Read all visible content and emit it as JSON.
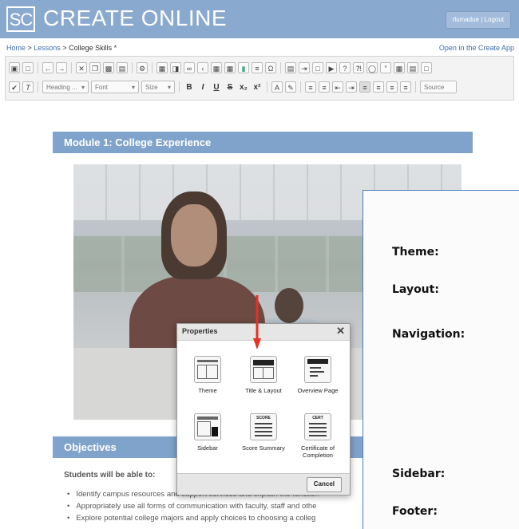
{
  "header": {
    "logo_mark": "SC",
    "app_title": "CREATE ONLINE",
    "user_button": "rlumadue | Logout"
  },
  "breadcrumb": {
    "home": "Home",
    "sep1": " > ",
    "lessons": "Lessons",
    "sep2": " > ",
    "current": "College Skills *"
  },
  "open_app_link": "Open in the Create App",
  "toolbar": {
    "heading_combo": "Heading ...",
    "font_combo": "Font",
    "size_combo": "Size",
    "bold": "B",
    "italic": "I",
    "underline": "U",
    "strike": "S",
    "sub": "x₂",
    "sup": "x²",
    "source": "Source"
  },
  "content": {
    "module_title": "Module 1: College Experience",
    "objectives_title": "Objectives",
    "intro": "Students will be able to:",
    "bullets": [
      "Identify campus resources and support services and explain the function",
      "Appropriately use all forms of communication with faculty, staff and othe",
      "Explore potential college majors and apply choices to choosing a colleg"
    ]
  },
  "dialog": {
    "title": "Properties",
    "close": "✕",
    "tiles": [
      {
        "label": "Theme"
      },
      {
        "label": "Title & Layout"
      },
      {
        "label": "Overview Page"
      },
      {
        "label": "Sidebar"
      },
      {
        "label": "Score Summary",
        "badge": "SCORE"
      },
      {
        "label": "Certificate of Completion",
        "badge": "CERT"
      }
    ],
    "cancel": "Cancel"
  },
  "panel": {
    "theme": "Theme:",
    "layout": "Layout:",
    "navigation": "Navigation:",
    "sidebar": "Sidebar:",
    "footer": "Footer:"
  },
  "colors": {
    "header_bg": "#8aa9cf",
    "section_bar": "#7fa3cb",
    "link": "#3a6fb0",
    "arrow": "#e53222"
  }
}
